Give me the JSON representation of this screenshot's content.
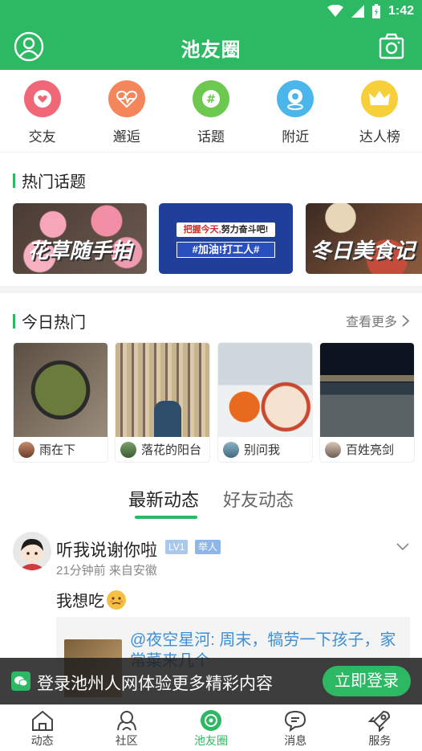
{
  "status_bar": {
    "time": "1:42"
  },
  "header": {
    "title": "池友圈"
  },
  "quick_menu": [
    {
      "label": "交友",
      "icon": "heart-icon",
      "color": "#f06878"
    },
    {
      "label": "邂逅",
      "icon": "heartbeat-icon",
      "color": "#f5855a"
    },
    {
      "label": "话题",
      "icon": "hashtag-icon",
      "color": "#6cc84e"
    },
    {
      "label": "附近",
      "icon": "location-icon",
      "color": "#4ab6ec"
    },
    {
      "label": "达人榜",
      "icon": "crown-icon",
      "color": "#f7cf3a"
    }
  ],
  "hot_topics": {
    "title": "热门话题",
    "cards": [
      {
        "text": "花草随手拍"
      },
      {
        "text": "#加油!打工人#",
        "line1": "把握今天,",
        "line2": "努力奋斗吧!"
      },
      {
        "text": "冬日美食记"
      }
    ]
  },
  "today_hot": {
    "title": "今日热门",
    "more": "查看更多",
    "items": [
      {
        "user": "雨在下"
      },
      {
        "user": "落花的阳台"
      },
      {
        "user": "别问我"
      },
      {
        "user": "百姓亮剑"
      }
    ]
  },
  "feed_tabs": {
    "latest": "最新动态",
    "friends": "好友动态"
  },
  "post": {
    "author": "听我说谢你啦",
    "level": "LV1",
    "badge": "举人",
    "meta": "21分钟前 来自安徽",
    "content": "我想吃",
    "quote_text": "@夜空星河: 周末，犒劳一下孩子，家常菜来几个"
  },
  "login_banner": {
    "text": "登录池州人网体验更多精彩内容",
    "button": "立即登录"
  },
  "bottom_nav": [
    {
      "label": "动态"
    },
    {
      "label": "社区"
    },
    {
      "label": "池友圈"
    },
    {
      "label": "消息"
    },
    {
      "label": "服务"
    }
  ]
}
